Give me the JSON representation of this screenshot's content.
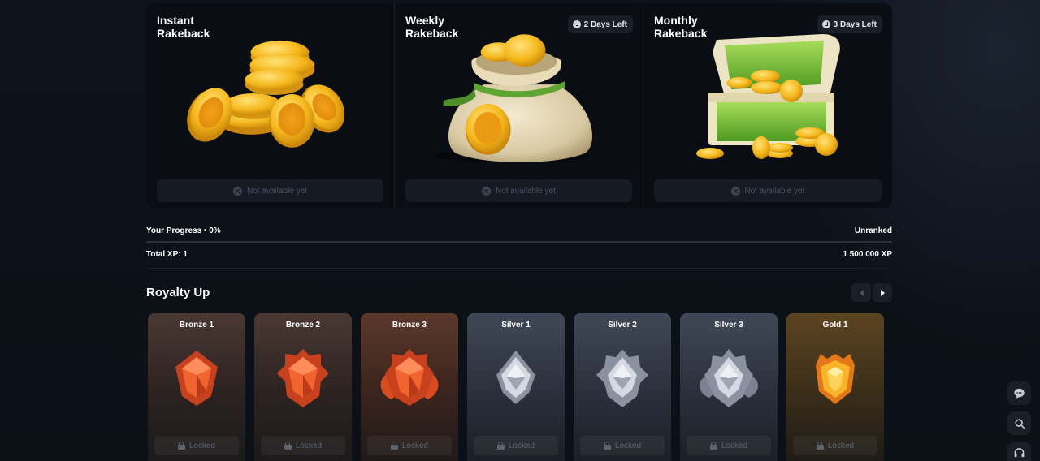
{
  "rakeback": [
    {
      "title": "Instant Rakeback",
      "badge": "",
      "button": "Not available yet"
    },
    {
      "title": "Weekly Rakeback",
      "badge": "2 Days Left",
      "button": "Not available yet"
    },
    {
      "title": "Monthly Rakeback",
      "badge": "3 Days Left",
      "button": "Not available yet"
    }
  ],
  "progress": {
    "label": "Your Progress • 0%",
    "rank": "Unranked",
    "value": 0,
    "total_xp": "Total XP: 1",
    "target_xp": "1 500 000 XP"
  },
  "royalty": {
    "title": "Royalty Up",
    "ranks": [
      {
        "name": "Bronze 1",
        "status": "Locked"
      },
      {
        "name": "Bronze 2",
        "status": "Locked"
      },
      {
        "name": "Bronze 3",
        "status": "Locked"
      },
      {
        "name": "Silver 1",
        "status": "Locked"
      },
      {
        "name": "Silver 2",
        "status": "Locked"
      },
      {
        "name": "Silver 3",
        "status": "Locked"
      },
      {
        "name": "Gold 1",
        "status": "Locked"
      }
    ]
  },
  "colors": {
    "background": "#0d1117",
    "card": "#0a0e14",
    "muted_text": "#4b5361",
    "coin_gold": "#f5b81c",
    "bronze": "#e2522a",
    "silver": "#b9bfcc",
    "gold": "#f7a21a"
  },
  "icons": [
    "clock-icon",
    "close-circle-icon",
    "lock-icon",
    "chevron-left-icon",
    "chevron-right-icon",
    "chat-icon",
    "search-icon",
    "headset-icon"
  ]
}
